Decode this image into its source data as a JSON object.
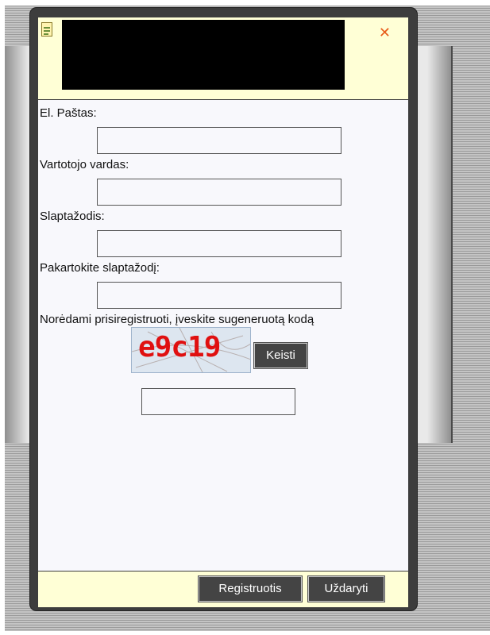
{
  "window": {
    "title_redacted": true
  },
  "form": {
    "email_label": "El. Paštas:",
    "username_label": "Vartotojo vardas:",
    "password_label": "Slaptažodis:",
    "repeat_password_label": "Pakartokite slaptažodį:",
    "captcha_prompt": "Norėdami prisiregistruoti, įveskite sugeneruotą kodą",
    "captcha_code": "e9c19",
    "change_captcha_label": "Keisti"
  },
  "footer": {
    "register_label": "Registruotis",
    "close_label": "Uždaryti"
  },
  "icons": {
    "window_icon": "note-icon",
    "close_icon": "close-icon",
    "close_color": "#e85c1a"
  }
}
